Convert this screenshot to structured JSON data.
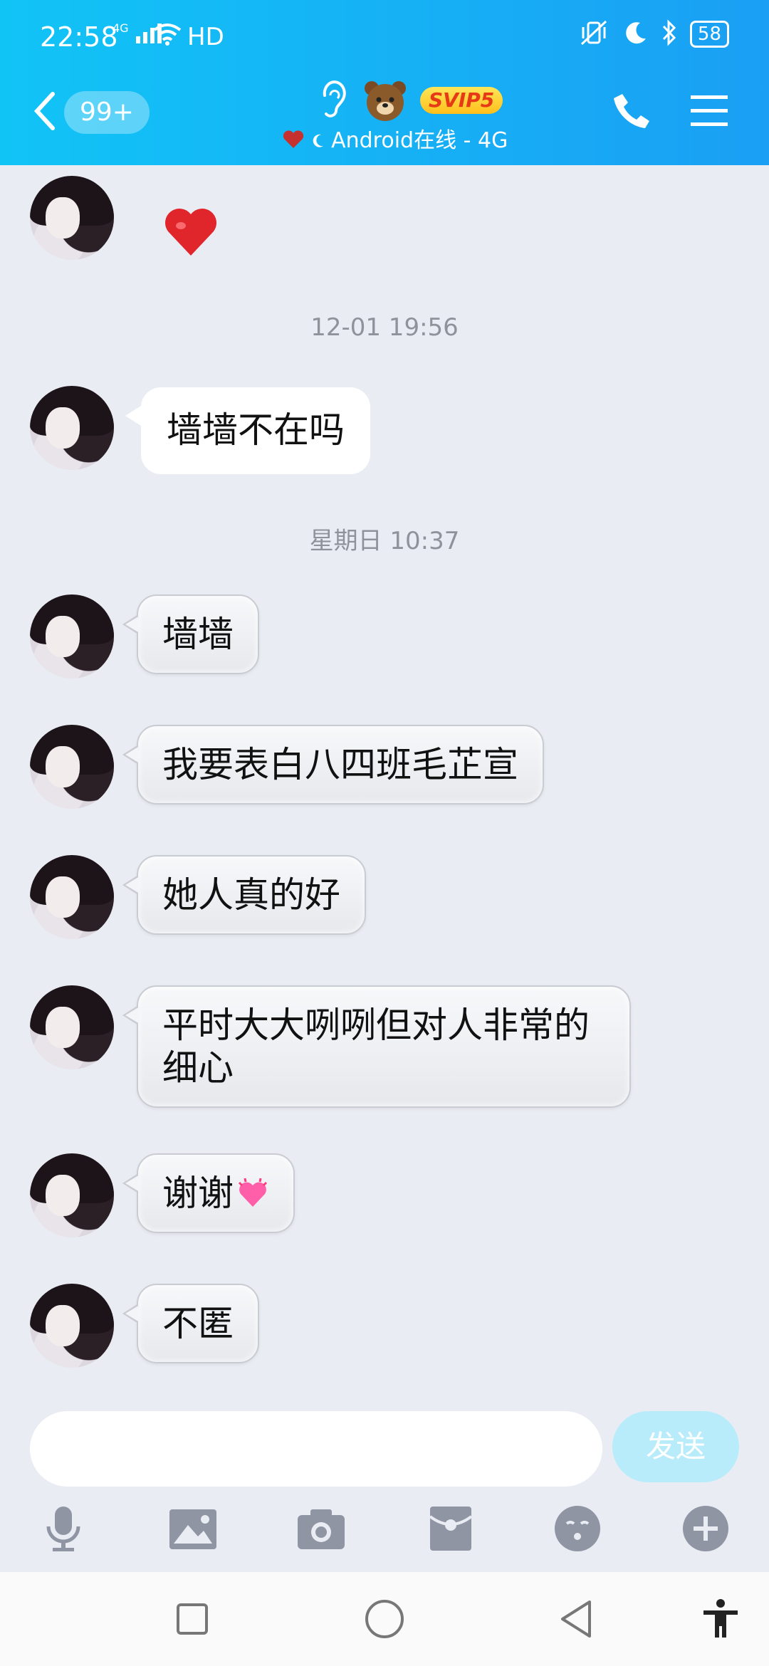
{
  "status_bar": {
    "time": "22:58",
    "signal": "4G",
    "network_label": "HD",
    "battery": "58"
  },
  "header": {
    "unread_badge": "99+",
    "vip_badge": "SVIP5",
    "online_status": "Android在线 - 4G",
    "colors": {
      "gradient_start": "#11c4f6",
      "gradient_end": "#1a9ff4"
    }
  },
  "messages": [
    {
      "type": "emoji",
      "icon": "red-heart"
    },
    {
      "type": "timestamp",
      "text": "12-01 19:56"
    },
    {
      "type": "text",
      "style": "white",
      "text": "墙墙不在吗"
    },
    {
      "type": "timestamp",
      "text": "星期日 10:37"
    },
    {
      "type": "text",
      "text": "墙墙"
    },
    {
      "type": "text",
      "text": "我要表白八四班毛芷宣"
    },
    {
      "type": "text",
      "text": "她人真的好"
    },
    {
      "type": "text",
      "text": "平时大大咧咧但对人非常的细心"
    },
    {
      "type": "text",
      "text": "谢谢",
      "emoji": "pink-heart"
    },
    {
      "type": "text",
      "text": "不匿"
    }
  ],
  "input": {
    "placeholder": "",
    "send_label": "发送",
    "tools": [
      "microphone-icon",
      "image-icon",
      "camera-icon",
      "red-envelope-icon",
      "sticker-icon",
      "plus-icon"
    ]
  },
  "navigation": [
    "recent-apps",
    "home",
    "back",
    "accessibility"
  ]
}
